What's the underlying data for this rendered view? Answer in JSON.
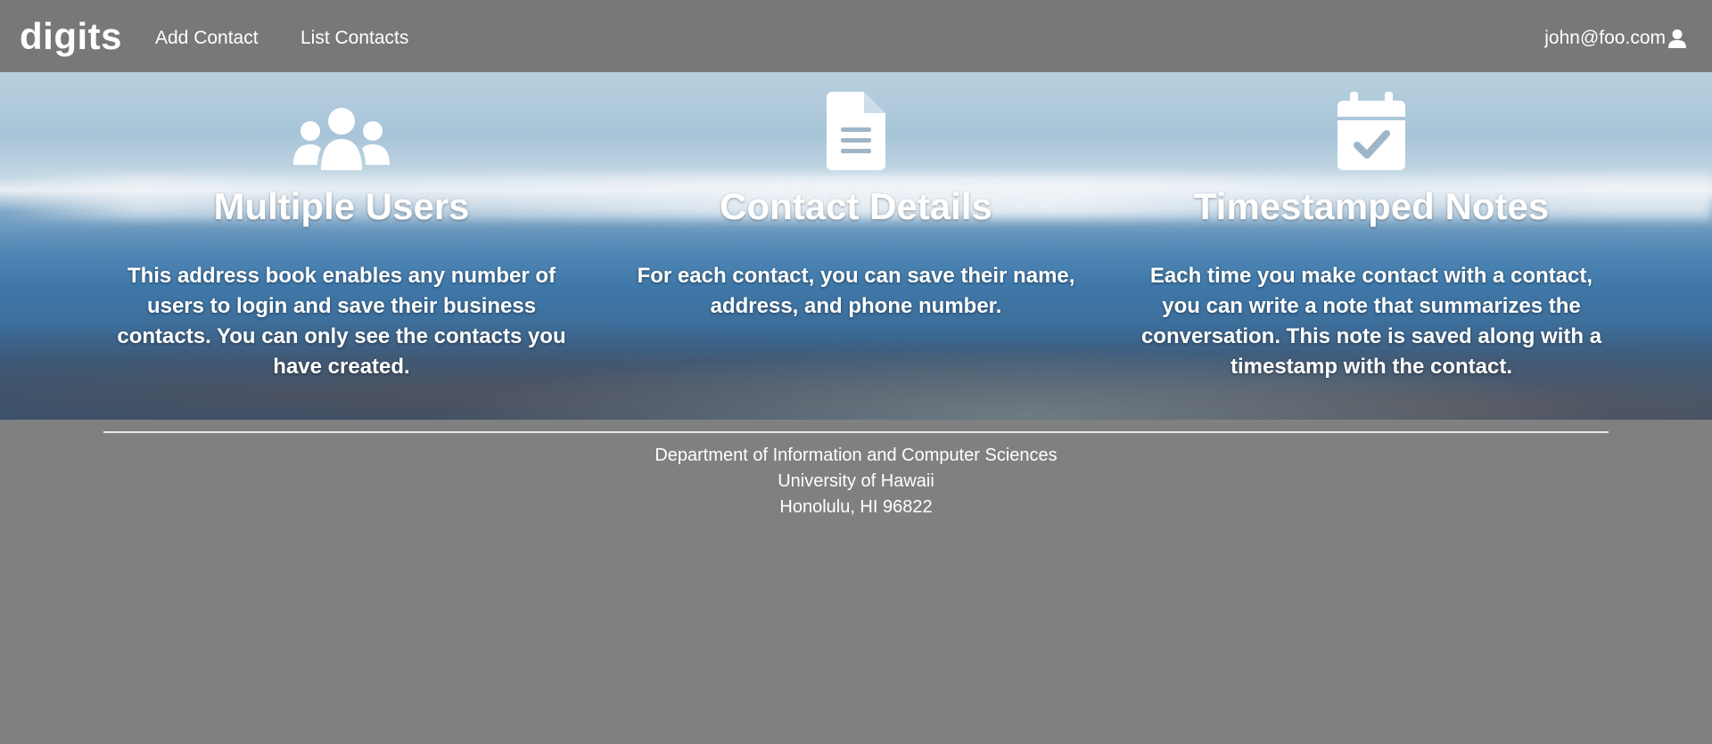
{
  "navbar": {
    "brand": "digits",
    "links": [
      "Add Contact",
      "List Contacts"
    ],
    "user_email": "john@foo.com",
    "user_icon": "user-icon"
  },
  "hero": {
    "features": [
      {
        "icon": "users-icon",
        "title": "Multiple Users",
        "text": "This address book enables any number of users to login and save their business contacts. You can only see the contacts you have created."
      },
      {
        "icon": "file-lines-icon",
        "title": "Contact Details",
        "text": "For each contact, you can save their name, address, and phone number."
      },
      {
        "icon": "calendar-check-icon",
        "title": "Timestamped Notes",
        "text": "Each time you make contact with a contact, you can write a note that summarizes the conversation. This note is saved along with a timestamp with the contact."
      }
    ]
  },
  "footer": {
    "lines": [
      "Department of Information and Computer Sciences",
      "University of Hawaii",
      "Honolulu, HI 96822"
    ]
  },
  "colors": {
    "page_background": "#808080",
    "navbar_background": "#787878",
    "text": "#ffffff"
  }
}
